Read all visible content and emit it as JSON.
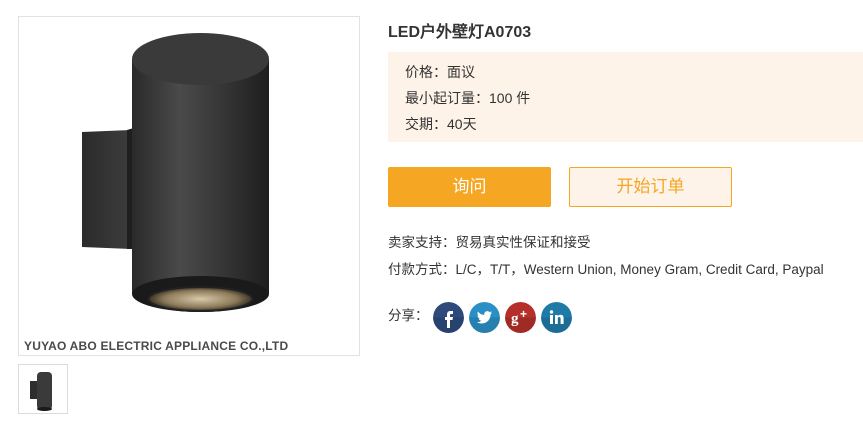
{
  "product": {
    "title": "LED户外壁灯A0703",
    "watermark": "YUYAO ABO ELECTRIC APPLIANCE CO.,LTD"
  },
  "info": {
    "price": "价格：面议",
    "moq": "最小起订量：100 件",
    "delivery": "交期：40天"
  },
  "buttons": {
    "inquire": "询问",
    "start_order": "开始订单"
  },
  "seller_support": "卖家支持：贸易真实性保证和接受",
  "payment_methods": "付款方式：L/C，T/T，Western Union, Money Gram, Credit Card, Paypal",
  "share": {
    "label": "分享：",
    "icons": [
      "facebook-icon",
      "twitter-icon",
      "google-plus-icon",
      "linkedin-icon"
    ]
  },
  "colors": {
    "accent": "#f5a623",
    "info_bg": "#fdf3e8"
  }
}
